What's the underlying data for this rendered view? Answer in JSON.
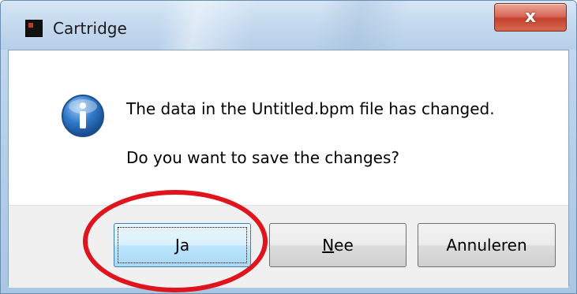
{
  "window": {
    "title": "Cartridge",
    "close_glyph": "x"
  },
  "message": {
    "line1": "The data in the Untitled.bpm file has changed.",
    "line2": "Do you want to save the changes?",
    "icon": "info-icon"
  },
  "buttons": {
    "yes": {
      "mnemonic": "J",
      "rest": "a"
    },
    "no": {
      "mnemonic": "N",
      "rest": "ee"
    },
    "cancel": {
      "label": "Annuleren"
    }
  },
  "annotation": {
    "highlight_color": "#e0141c",
    "highlight_target": "yes-button"
  },
  "colors": {
    "accent": "#3c7fb1",
    "close": "#c4422f"
  }
}
